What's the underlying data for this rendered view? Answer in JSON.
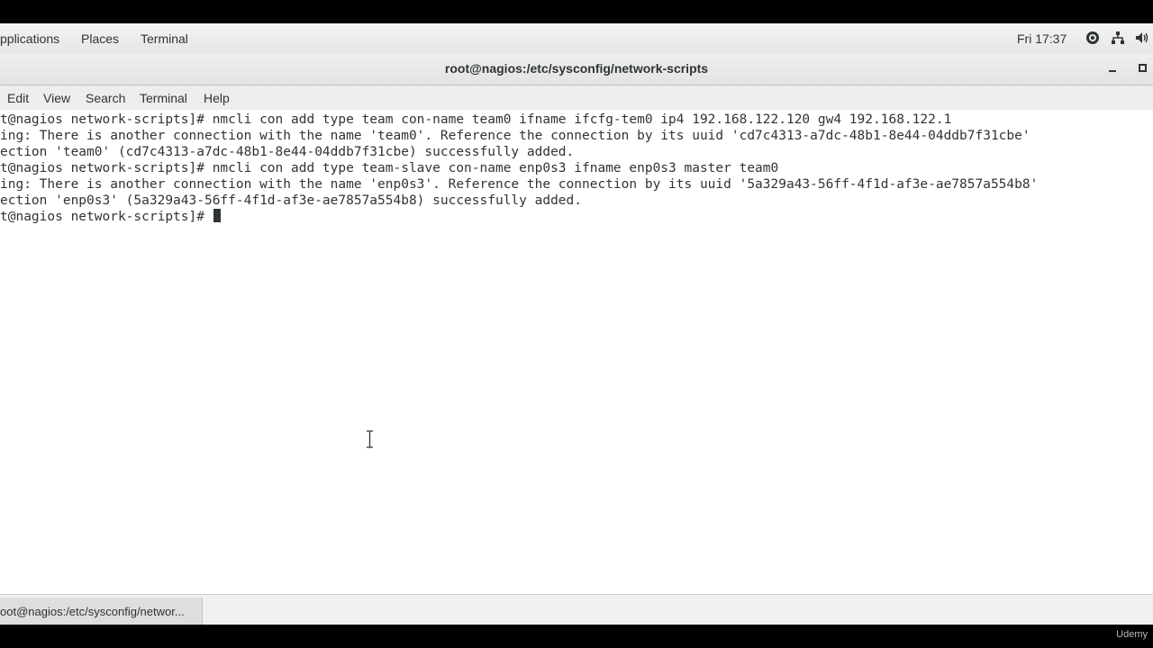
{
  "panel": {
    "menus": [
      "pplications",
      "Places",
      "Terminal"
    ],
    "clock": "Fri 17:37",
    "status_icons": [
      "accessibility-icon",
      "network-icon",
      "volume-icon"
    ]
  },
  "window": {
    "title": "root@nagios:/etc/sysconfig/network-scripts"
  },
  "menubar": {
    "items": [
      "Edit",
      "View",
      "Search",
      "Terminal",
      "Help"
    ]
  },
  "terminal": {
    "lines": [
      "t@nagios network-scripts]# nmcli con add type team con-name team0 ifname ifcfg-tem0 ip4 192.168.122.120 gw4 192.168.122.1",
      "ing: There is another connection with the name 'team0'. Reference the connection by its uuid 'cd7c4313-a7dc-48b1-8e44-04ddb7f31cbe'",
      "ection 'team0' (cd7c4313-a7dc-48b1-8e44-04ddb7f31cbe) successfully added.",
      "t@nagios network-scripts]# nmcli con add type team-slave con-name enp0s3 ifname enp0s3 master team0",
      "ing: There is another connection with the name 'enp0s3'. Reference the connection by its uuid '5a329a43-56ff-4f1d-af3e-ae7857a554b8'",
      "ection 'enp0s3' (5a329a43-56ff-4f1d-af3e-ae7857a554b8) successfully added.",
      "t@nagios network-scripts]# "
    ]
  },
  "taskbar": {
    "window_label": "oot@nagios:/etc/sysconfig/networ..."
  },
  "watermark": "Udemy",
  "colors": {
    "terminal_bg": "#ffffff",
    "terminal_fg": "#2e3436",
    "panel_bg": "#f0f0ee"
  }
}
